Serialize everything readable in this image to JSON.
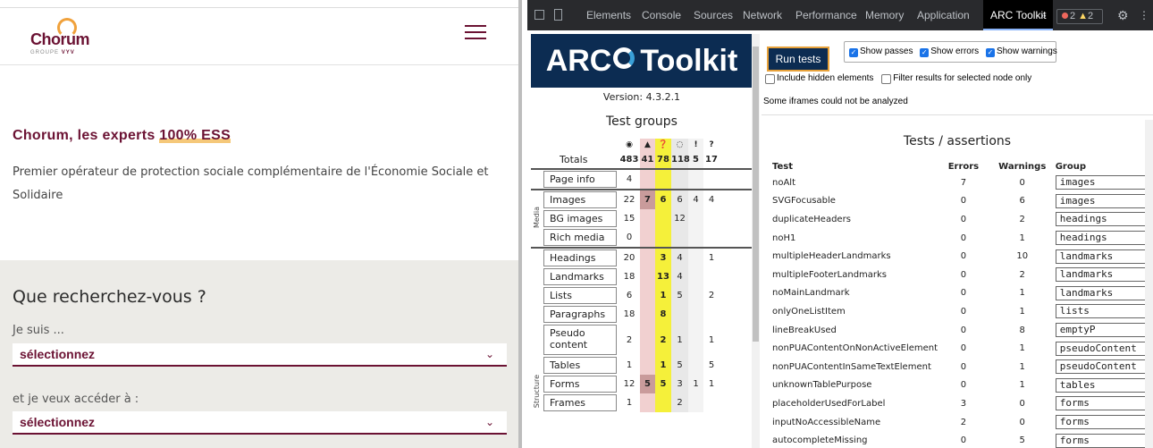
{
  "site": {
    "logo_word": "Chorum",
    "logo_sub_prefix": "GROUPE",
    "logo_sub_brand": "VYV",
    "hero_title_prefix": "Chorum, les experts ",
    "hero_title_highlight": "100% ESS",
    "hero_text": "Premier opérateur de protection sociale complémentaire de l'Économie Sociale et Solidaire",
    "search_title": "Que recherchez-vous ?",
    "field1_label": "Je suis ...",
    "field1_value": "sélectionnez",
    "field2_label": "et je veux accéder à :",
    "field2_value": "sélectionnez",
    "brand_color": "#6b1233"
  },
  "devtools": {
    "tabs": [
      "Elements",
      "Console",
      "Sources",
      "Network",
      "Performance",
      "Memory",
      "Application",
      "ARC Toolkit"
    ],
    "active_tab": "ARC Toolkit",
    "more": "»",
    "errors_count": "2",
    "warnings_count": "2"
  },
  "arc": {
    "banner": "ARC Toolkit",
    "version": "Version: 4.3.2.1",
    "test_groups_title": "Test groups",
    "col_headers": [
      "◉",
      "▲",
      "❓",
      "◌",
      "!",
      "?"
    ],
    "totals": {
      "label": "Totals",
      "values": [
        "483",
        "41",
        "78",
        "118",
        "5",
        "17"
      ]
    },
    "page_info": {
      "label": "Page info",
      "value": "4"
    },
    "media_label": "Media",
    "structure_label": "Structure",
    "media_rows": [
      {
        "label": "Images",
        "v": [
          "22",
          "7",
          "6",
          "6",
          "4",
          "4"
        ]
      },
      {
        "label": "BG images",
        "v": [
          "15",
          "",
          "",
          "12",
          "",
          ""
        ]
      },
      {
        "label": "Rich media",
        "v": [
          "0",
          "",
          "",
          "",
          "",
          ""
        ]
      }
    ],
    "structure_rows": [
      {
        "label": "Headings",
        "v": [
          "20",
          "",
          "3",
          "4",
          "",
          "1"
        ]
      },
      {
        "label": "Landmarks",
        "v": [
          "18",
          "",
          "13",
          "4",
          "",
          ""
        ]
      },
      {
        "label": "Lists",
        "v": [
          "6",
          "",
          "1",
          "5",
          "",
          "2"
        ]
      },
      {
        "label": "Paragraphs",
        "v": [
          "18",
          "",
          "8",
          "",
          "",
          ""
        ]
      },
      {
        "label": "Pseudo content",
        "v": [
          "2",
          "",
          "2",
          "1",
          "",
          "1"
        ]
      },
      {
        "label": "Tables",
        "v": [
          "1",
          "",
          "1",
          "5",
          "",
          "5"
        ]
      },
      {
        "label": "Forms",
        "v": [
          "12",
          "5",
          "5",
          "3",
          "1",
          "1"
        ]
      },
      {
        "label": "Frames",
        "v": [
          "1",
          "",
          "",
          "2",
          "",
          ""
        ]
      }
    ]
  },
  "results": {
    "run_button": "Run tests",
    "show_passes": "Show passes",
    "show_errors": "Show errors",
    "show_warnings": "Show warnings",
    "include_hidden": "Include hidden elements",
    "filter_selected": "Filter results for selected node only",
    "iframes_note": "Some iframes could not be analyzed",
    "title": "Tests / assertions",
    "headers": [
      "Test",
      "Errors",
      "Warnings",
      "Group"
    ],
    "rows": [
      {
        "test": "noAlt",
        "errors": "7",
        "warnings": "0",
        "group": "images"
      },
      {
        "test": "SVGFocusable",
        "errors": "0",
        "warnings": "6",
        "group": "images"
      },
      {
        "test": "duplicateHeaders",
        "errors": "0",
        "warnings": "2",
        "group": "headings"
      },
      {
        "test": "noH1",
        "errors": "0",
        "warnings": "1",
        "group": "headings"
      },
      {
        "test": "multipleHeaderLandmarks",
        "errors": "0",
        "warnings": "10",
        "group": "landmarks"
      },
      {
        "test": "multipleFooterLandmarks",
        "errors": "0",
        "warnings": "2",
        "group": "landmarks"
      },
      {
        "test": "noMainLandmark",
        "errors": "0",
        "warnings": "1",
        "group": "landmarks"
      },
      {
        "test": "onlyOneListItem",
        "errors": "0",
        "warnings": "1",
        "group": "lists"
      },
      {
        "test": "lineBreakUsed",
        "errors": "0",
        "warnings": "8",
        "group": "emptyP"
      },
      {
        "test": "nonPUAContentOnNonActiveElement",
        "errors": "0",
        "warnings": "1",
        "group": "pseudoContent"
      },
      {
        "test": "nonPUAContentInSameTextElement",
        "errors": "0",
        "warnings": "1",
        "group": "pseudoContent"
      },
      {
        "test": "unknownTablePurpose",
        "errors": "0",
        "warnings": "1",
        "group": "tables"
      },
      {
        "test": "placeholderUsedForLabel",
        "errors": "3",
        "warnings": "0",
        "group": "forms"
      },
      {
        "test": "inputNoAccessibleName",
        "errors": "2",
        "warnings": "0",
        "group": "forms"
      },
      {
        "test": "autocompleteMissing",
        "errors": "0",
        "warnings": "5",
        "group": "forms"
      }
    ]
  }
}
